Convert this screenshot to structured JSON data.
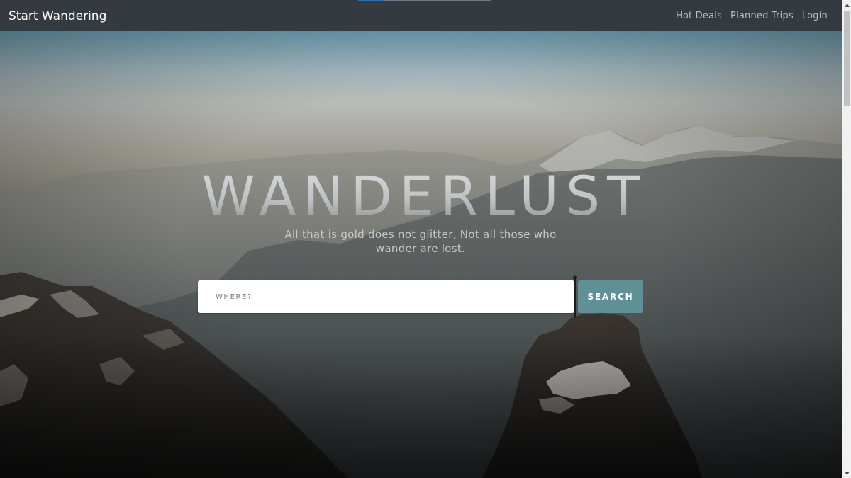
{
  "navbar": {
    "brand": "Start Wandering",
    "links": [
      {
        "label": "Hot Deals"
      },
      {
        "label": "Planned Trips"
      },
      {
        "label": "Login"
      }
    ]
  },
  "hero": {
    "headline": "WANDERLUST",
    "tagline": "All that is gold does not glitter, Not all those who wander are lost."
  },
  "search": {
    "placeholder": "WHERE?",
    "value": "",
    "button_label": "SEARCH"
  },
  "colors": {
    "navbar_bg": "#343a40",
    "nav_link": "#b7bcc1",
    "button_bg": "#5e9095",
    "input_bg": "#ffffff"
  },
  "icons": [
    "scroll-up-arrow-icon",
    "scroll-down-arrow-icon"
  ]
}
